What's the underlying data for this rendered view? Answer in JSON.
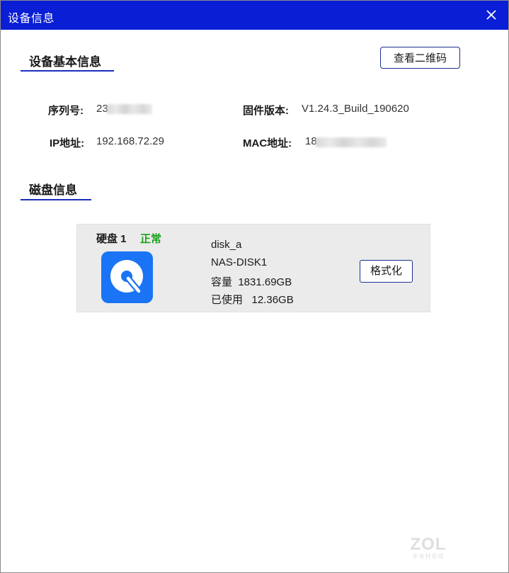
{
  "window": {
    "title": "设备信息",
    "titlebar_color": "#0a1ed6",
    "close_icon": "close-icon"
  },
  "basic": {
    "heading": "设备基本信息",
    "qr_button": "查看二维码",
    "serial_label": "序列号:",
    "serial_value": "23",
    "firmware_label": "固件版本:",
    "firmware_value": "V1.24.3_Build_190620",
    "ip_label": "IP地址:",
    "ip_value": "192.168.72.29",
    "mac_label": "MAC地址:",
    "mac_value": "18"
  },
  "disk": {
    "heading": "磁盘信息",
    "card": {
      "title": "硬盘 1",
      "status": "正常",
      "status_color": "#17a317",
      "icon": "hard-disk-icon",
      "icon_color": "#1a74f5",
      "name": "disk_a",
      "model": "NAS-DISK1",
      "capacity": "容量  1831.69GB",
      "used": "已使用   12.36GB",
      "format_button": "格式化"
    }
  },
  "watermark": {
    "logo": "ZOL",
    "subtitle": "中关村在线"
  }
}
